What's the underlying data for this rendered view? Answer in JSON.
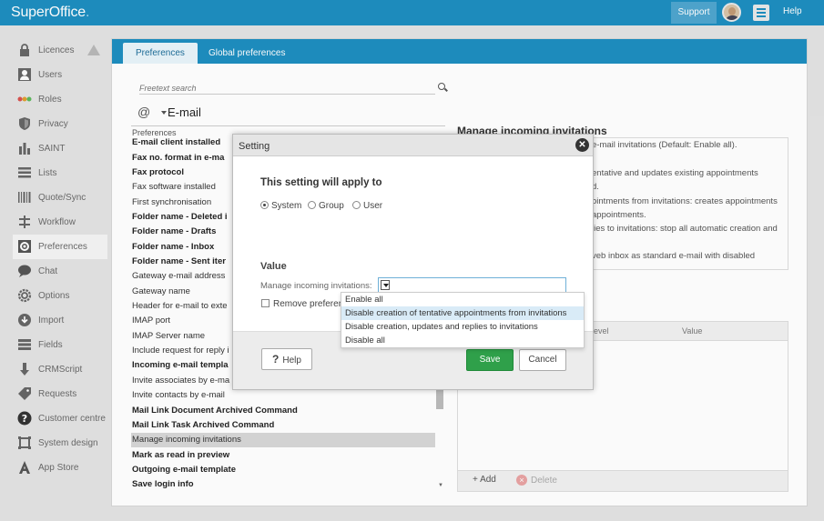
{
  "topbar": {
    "logo": "SuperOffice",
    "logo_dot": ".",
    "support_label": "Support",
    "help_label": "Help"
  },
  "sidebar": {
    "items": [
      {
        "label": "Licences",
        "icon": "lock-icon"
      },
      {
        "label": "Users",
        "icon": "user-icon"
      },
      {
        "label": "Roles",
        "icon": "roles-icon"
      },
      {
        "label": "Privacy",
        "icon": "shield-icon"
      },
      {
        "label": "SAINT",
        "icon": "bar-chart-icon"
      },
      {
        "label": "Lists",
        "icon": "list-icon"
      },
      {
        "label": "Quote/Sync",
        "icon": "barcode-icon"
      },
      {
        "label": "Workflow",
        "icon": "workflow-icon"
      },
      {
        "label": "Preferences",
        "icon": "gear-icon"
      },
      {
        "label": "Chat",
        "icon": "chat-icon"
      },
      {
        "label": "Options",
        "icon": "options-gear-icon"
      },
      {
        "label": "Import",
        "icon": "import-icon"
      },
      {
        "label": "Fields",
        "icon": "fields-icon"
      },
      {
        "label": "CRMScript",
        "icon": "crmscript-icon"
      },
      {
        "label": "Requests",
        "icon": "tag-icon"
      },
      {
        "label": "Customer centre",
        "icon": "question-icon"
      },
      {
        "label": "System design",
        "icon": "system-design-icon"
      },
      {
        "label": "App Store",
        "icon": "app-store-icon"
      }
    ],
    "active_index": 8
  },
  "tabs": [
    {
      "label": "Preferences"
    },
    {
      "label": "Global preferences"
    }
  ],
  "search": {
    "placeholder": "Freetext search"
  },
  "category": {
    "title": "E-mail",
    "icon": "at-icon"
  },
  "preferences_list": {
    "header": "Preferences",
    "rows": [
      {
        "label": "E-mail client installed",
        "bold": true
      },
      {
        "label": "Fax no. format in e-ma",
        "bold": true
      },
      {
        "label": "Fax protocol",
        "bold": true
      },
      {
        "label": "Fax software installed",
        "bold": false
      },
      {
        "label": "First synchronisation",
        "bold": false
      },
      {
        "label": "Folder name - Deleted i",
        "bold": true
      },
      {
        "label": "Folder name - Drafts",
        "bold": true
      },
      {
        "label": "Folder name - Inbox",
        "bold": true
      },
      {
        "label": "Folder name - Sent iter",
        "bold": true
      },
      {
        "label": "Gateway e-mail address",
        "bold": false
      },
      {
        "label": "Gateway name",
        "bold": false
      },
      {
        "label": "Header for e-mail to exte",
        "bold": false
      },
      {
        "label": "IMAP port",
        "bold": false
      },
      {
        "label": "IMAP Server name",
        "bold": false
      },
      {
        "label": "Include request for reply i",
        "bold": false
      },
      {
        "label": "Incoming e-mail templa",
        "bold": true
      },
      {
        "label": "Invite associates by e-ma",
        "bold": false
      },
      {
        "label": "Invite contacts by e-mail",
        "bold": false
      },
      {
        "label": "Mail Link Document Archived Command",
        "bold": true
      },
      {
        "label": "Mail Link Task Archived Command",
        "bold": true
      },
      {
        "label": "Manage incoming invitations",
        "bold": false,
        "selected": true
      },
      {
        "label": "Mark as read in preview",
        "bold": true
      },
      {
        "label": "Outgoing e-mail template",
        "bold": true
      },
      {
        "label": "Save login info",
        "bold": true
      }
    ]
  },
  "details": {
    "title": "Manage incoming invitations",
    "description_lines": [
      "e-mail invitations (Default: Enable all).",
      "",
      "entative and updates existing appointments",
      "d.",
      "ointments from invitations: creates appointments",
      "appointments.",
      "lies to invitations: stop all automatic creation and",
      "",
      "veb inbox as standard e-mail with disabled"
    ],
    "grid_headers": {
      "level": "level",
      "value": "Value"
    },
    "add_label": "Add",
    "delete_label": "Delete"
  },
  "dialog": {
    "title": "Setting",
    "applies_heading": "This setting will apply to",
    "radios": [
      {
        "label": "System",
        "checked": true
      },
      {
        "label": "Group",
        "checked": false
      },
      {
        "label": "User",
        "checked": false
      }
    ],
    "value_heading": "Value",
    "field_label": "Manage incoming invitations:",
    "select_value": "",
    "checkbox_label": "Remove preferenc",
    "help_label": "Help",
    "save_label": "Save",
    "cancel_label": "Cancel"
  },
  "dropdown": {
    "options": [
      {
        "label": "Enable all"
      },
      {
        "label": "Disable creation of tentative appointments from invitations",
        "highlighted": true
      },
      {
        "label": "Disable creation, updates and replies to invitations"
      },
      {
        "label": "Disable all"
      }
    ]
  },
  "colors": {
    "brand_blue": "#1e8ec0",
    "save_green": "#2fa04a",
    "highlight": "#d9ebf7"
  }
}
